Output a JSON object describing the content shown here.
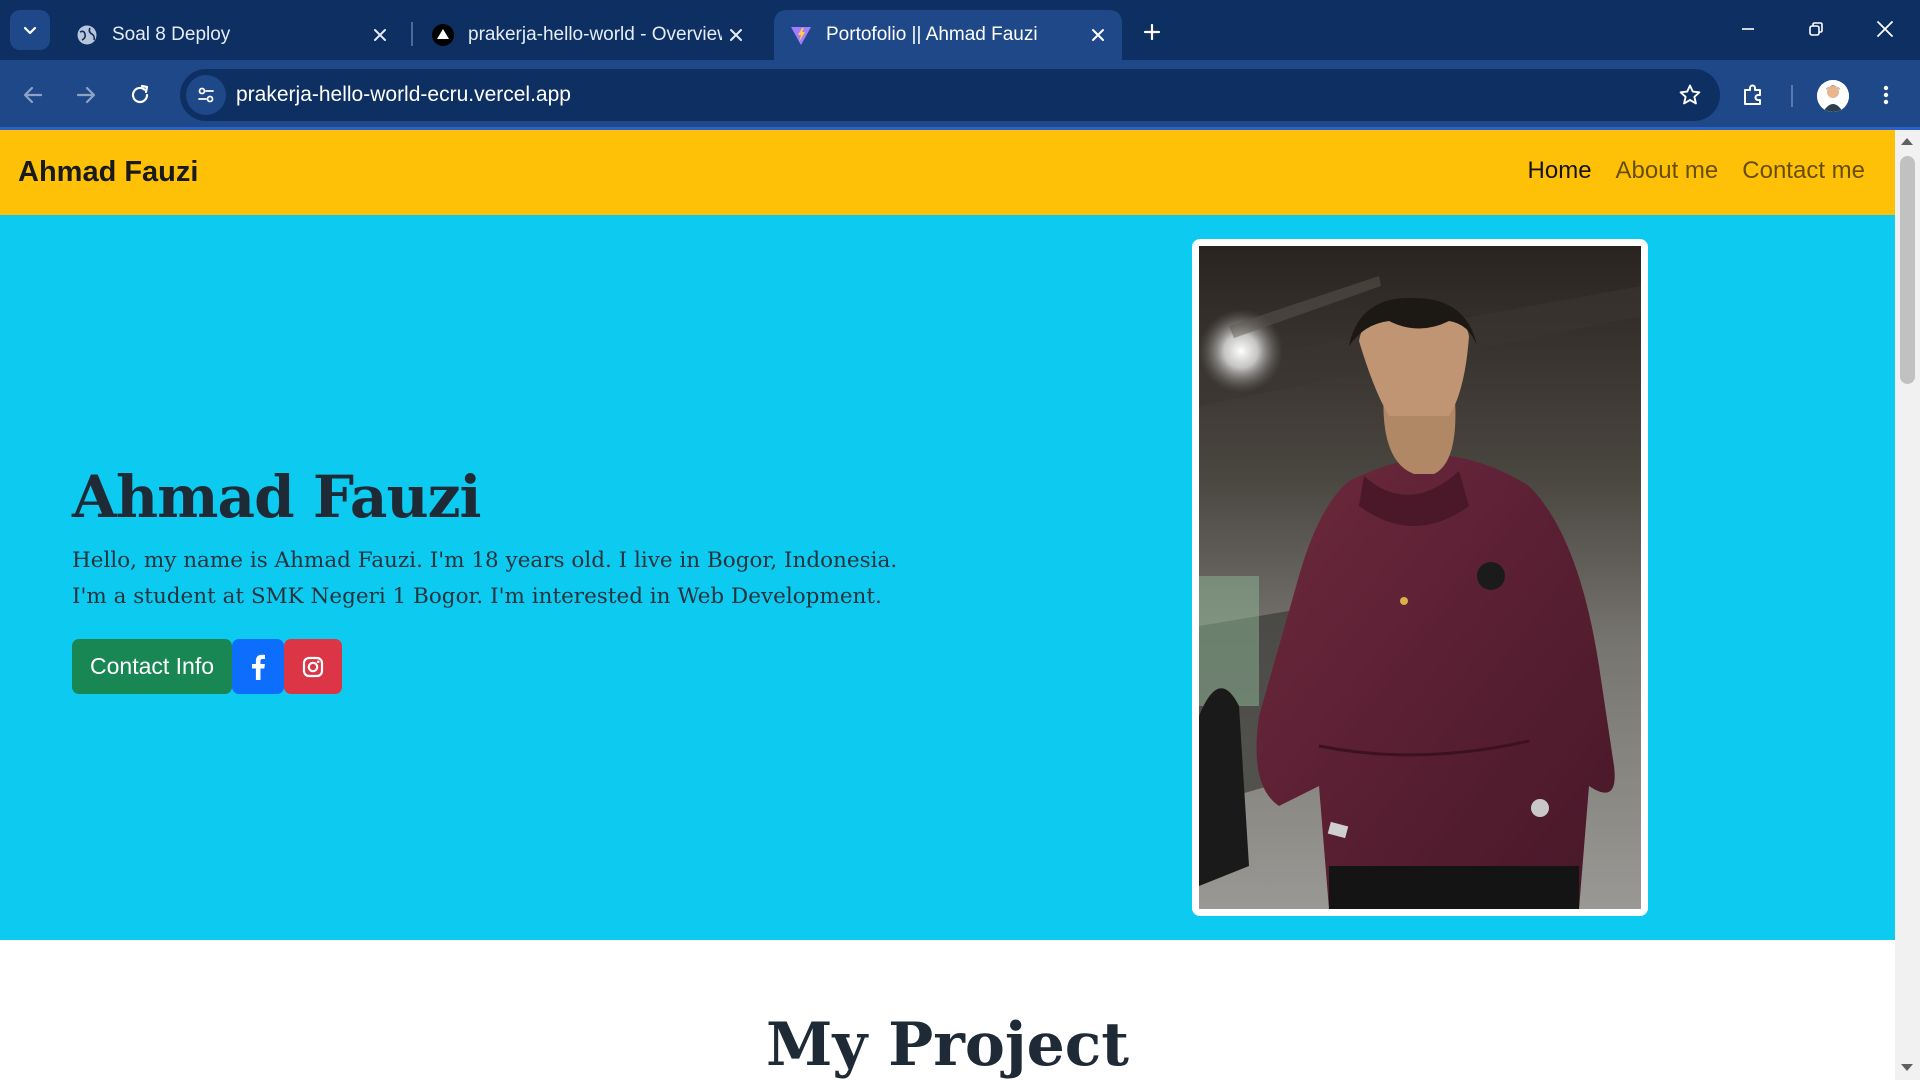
{
  "browser": {
    "tabs": [
      {
        "title": "Soal 8 Deploy",
        "icon": "globe-icon"
      },
      {
        "title": "prakerja-hello-world - Overview",
        "icon": "vercel-icon"
      },
      {
        "title": "Portofolio || Ahmad Fauzi",
        "icon": "vite-icon",
        "active": true
      }
    ],
    "url": "prakerja-hello-world-ecru.vercel.app"
  },
  "navbar": {
    "brand": "Ahmad Fauzi",
    "links": [
      "Home",
      "About me",
      "Contact me"
    ]
  },
  "hero": {
    "name": "Ahmad Fauzi",
    "bio": "Hello, my name is Ahmad Fauzi. I'm 18 years old. I live in Bogor, Indonesia. I'm a student at SMK Negeri 1 Bogor. I'm interested in Web Development.",
    "contact_button": "Contact Info"
  },
  "projects": {
    "title": "My Project"
  },
  "colors": {
    "navbar": "#ffc107",
    "hero": "#0dcaf0",
    "contact_button": "#198754",
    "facebook_button": "#0d6efd",
    "instagram_button": "#dc3545",
    "chrome": "#0d2f62"
  }
}
